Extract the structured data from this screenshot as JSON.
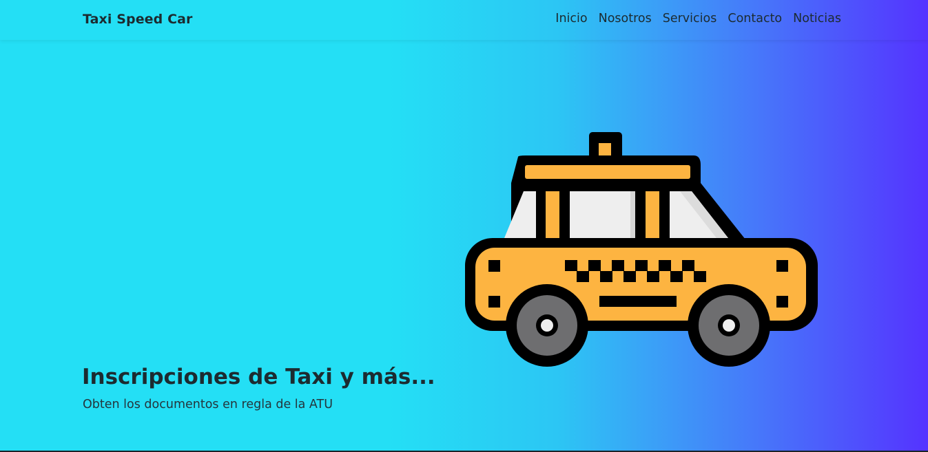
{
  "navbar": {
    "brand": "Taxi Speed Car",
    "links": [
      "Inicio",
      "Nosotros",
      "Servicios",
      "Contacto",
      "Noticias"
    ]
  },
  "hero": {
    "title": "Inscripciones de Taxi y más...",
    "subtitle": "Obten los documentos en regla de la ATU",
    "illustration": "taxi-car-icon"
  },
  "colors": {
    "gradient_start": "#24dff5",
    "gradient_end": "#5533ff",
    "taxi_yellow": "#fdb441",
    "taxi_outline": "#000000",
    "window": "#eeeeee",
    "wheel": "#6e6e70"
  }
}
